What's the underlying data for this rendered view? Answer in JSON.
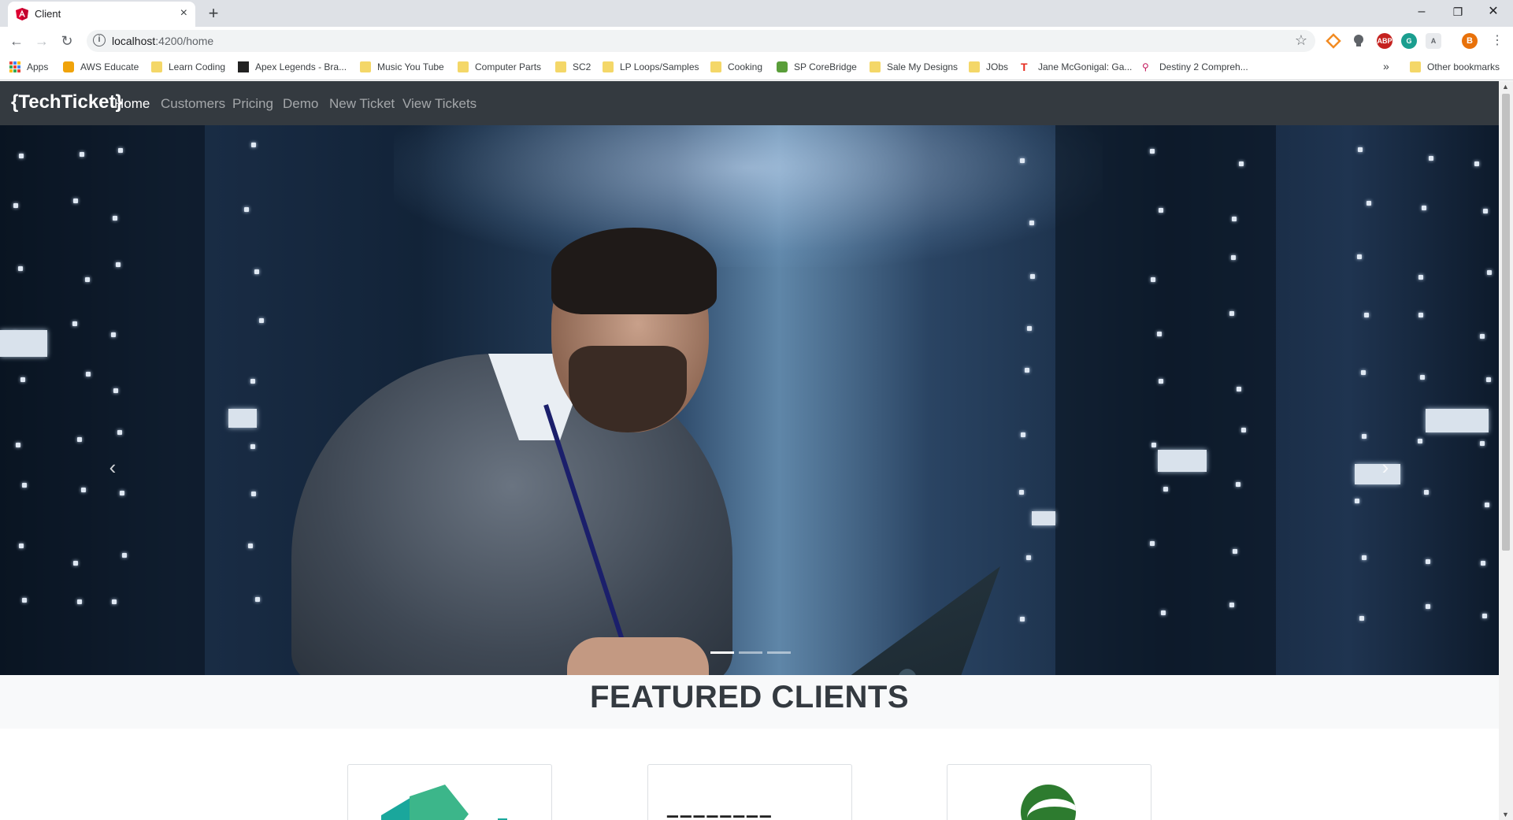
{
  "browser": {
    "tab_title": "Client",
    "tab_close": "×",
    "new_tab": "+",
    "url_host": "localhost",
    "url_rest": ":4200/home",
    "window_controls": {
      "minimize": "–",
      "restore": "❐",
      "close": "✕"
    },
    "extensions": [
      "ABP",
      "B"
    ]
  },
  "bookmarks": [
    {
      "label": "Apps",
      "icon": "apps-grid-icon"
    },
    {
      "label": "AWS Educate",
      "icon": "aws-icon"
    },
    {
      "label": "Learn Coding",
      "icon": "folder-icon"
    },
    {
      "label": "Apex Legends - Bra...",
      "icon": "apex-icon"
    },
    {
      "label": "Music You Tube",
      "icon": "folder-icon"
    },
    {
      "label": "Computer Parts",
      "icon": "folder-icon"
    },
    {
      "label": "SC2",
      "icon": "folder-icon"
    },
    {
      "label": "LP Loops/Samples",
      "icon": "folder-icon"
    },
    {
      "label": "Cooking",
      "icon": "folder-icon"
    },
    {
      "label": "SP CoreBridge",
      "icon": "sp-icon"
    },
    {
      "label": "Sale My Designs",
      "icon": "folder-icon"
    },
    {
      "label": "JObs",
      "icon": "folder-icon"
    },
    {
      "label": "Jane McGonigal: Ga...",
      "icon": "ted-icon"
    },
    {
      "label": "Destiny 2 Compreh...",
      "icon": "destiny-icon"
    }
  ],
  "bookmarks_overflow": "»",
  "other_bookmarks": "Other bookmarks",
  "site": {
    "brand": "{TechTicket}",
    "nav": [
      "Home",
      "Customers",
      "Pricing",
      "Demo",
      "New Ticket",
      "View Tickets"
    ],
    "active_nav": "Home",
    "carousel": {
      "prev": "‹",
      "next": "›",
      "slides": 3,
      "active_slide": 1
    },
    "featured_title": "FEATURED CLIENTS",
    "colors": {
      "navbar": "#343a40",
      "featured_band": "#f8f9fa"
    }
  }
}
